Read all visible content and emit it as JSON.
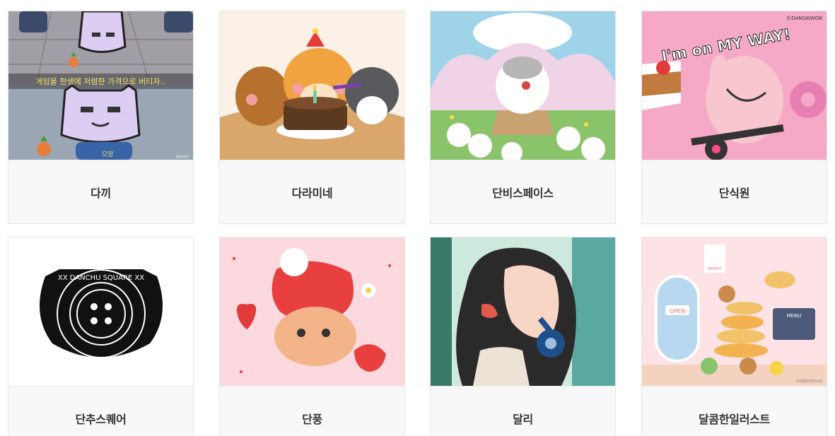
{
  "artists": [
    {
      "name": "다끼",
      "image_alt": "cartoon bunny illustration",
      "image_caption": "게임을 한생에 저렴한 가격으로 버티자..",
      "image_caption_2": "으앙",
      "signature": "@dakki"
    },
    {
      "name": "다라미네",
      "image_alt": "squirrel birthday illustration"
    },
    {
      "name": "단비스페이스",
      "image_alt": "hamster in cherry blossom field illustration"
    },
    {
      "name": "단식원",
      "image_alt": "pink bunny on exercise bike illustration",
      "image_caption": "I'm on MY WAY!",
      "signature": "©DANSIKWON"
    },
    {
      "name": "단추스퀘어",
      "image_alt": "DANCHU SQUARE button logo",
      "logo_text": "XX DANCHU SQUARE XX"
    },
    {
      "name": "단풍",
      "image_alt": "strawberry puppy illustration"
    },
    {
      "name": "달리",
      "image_alt": "girl on telephone illustration"
    },
    {
      "name": "달콤한일러스트",
      "image_alt": "bakery cafe illustration",
      "sign_text_1": "OPEN",
      "sign_text_2": "MENU",
      "sign_text_3": "PARFAIT",
      "signature": "©달콤한일러스트"
    }
  ],
  "colors": {
    "card_border": "#e6e6e6",
    "caption_bg": "#f8f8f8",
    "caption_text": "#333333"
  }
}
